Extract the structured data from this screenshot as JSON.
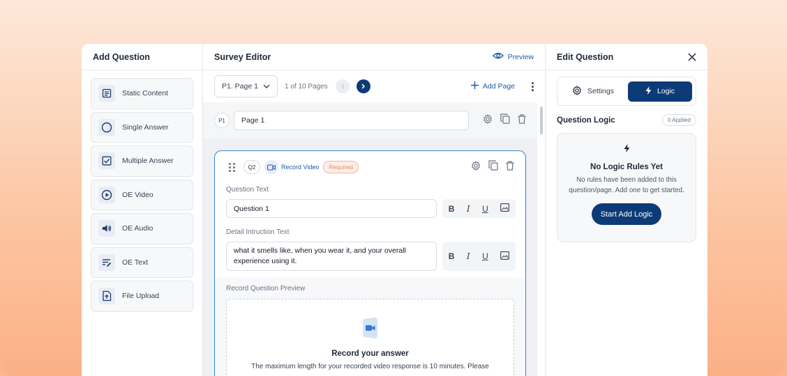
{
  "left_panel": {
    "title": "Add Question",
    "items": [
      {
        "label": "Static Content",
        "icon": "static-content-icon"
      },
      {
        "label": "Single Answer",
        "icon": "radio-circle-icon"
      },
      {
        "label": "Multiple Answer",
        "icon": "checkbox-icon"
      },
      {
        "label": "OE Video",
        "icon": "play-circle-icon"
      },
      {
        "label": "OE Audio",
        "icon": "speaker-icon"
      },
      {
        "label": "OE Text",
        "icon": "text-edit-icon"
      },
      {
        "label": "File Upload",
        "icon": "file-upload-icon"
      }
    ]
  },
  "editor": {
    "title": "Survey Editor",
    "preview_label": "Preview",
    "page_select": "P1. Page 1",
    "pages_count": "1 of 10 Pages",
    "add_page_label": "Add Page",
    "page_row": {
      "badge": "P1",
      "name": "Page 1"
    },
    "question": {
      "number": "Q2",
      "type_label": "Record Video",
      "required_label": "Required",
      "question_text_label": "Question Text",
      "question_text_value": "Question 1",
      "detail_label": "Detail Intruction Text",
      "detail_value": "what it smells like, when you wear it, and your overall experience using it.",
      "preview_label": "Record Question Preview",
      "record_title": "Record your answer",
      "record_sub": "The maximum length for your recorded video response is 10 minutes. Please"
    },
    "format": {
      "bold": "B",
      "italic": "I",
      "underline": "U"
    }
  },
  "right_panel": {
    "title": "Edit Question",
    "tab_settings": "Settings",
    "tab_logic": "Logic",
    "question_logic_title": "Question Logic",
    "applied_badge": "0 Applied",
    "empty_title": "No Logic Rules Yet",
    "empty_desc": "No rules have been added to this question/page. Add one to get started.",
    "start_button": "Start Add Logic"
  },
  "colors": {
    "primary": "#0d3b78",
    "link": "#1e5aa8",
    "required": "#e58a66",
    "card_border": "#3b82c4"
  }
}
